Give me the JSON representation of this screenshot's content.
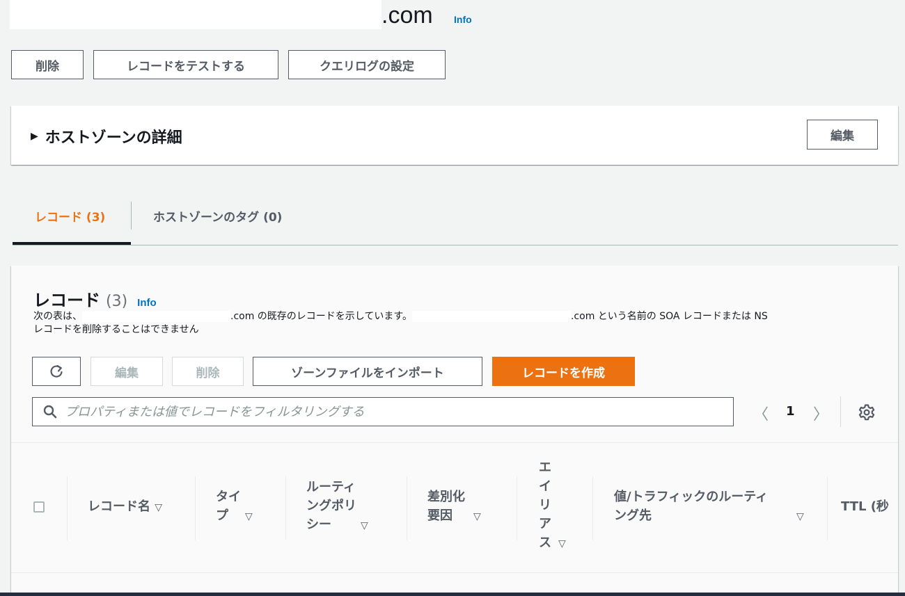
{
  "header": {
    "domain_suffix": ".com",
    "info": "Info"
  },
  "actions": {
    "delete": "削除",
    "test_record": "レコードをテストする",
    "query_log": "クエリログの設定"
  },
  "hosted_zone_details": {
    "title": "ホストゾーンの詳細",
    "edit": "編集"
  },
  "tabs": [
    {
      "label": "レコード (3)"
    },
    {
      "label": "ホストゾーンのタグ (0)"
    }
  ],
  "records": {
    "title": "レコード",
    "count": "(3)",
    "info": "Info",
    "desc_1": "次の表は、",
    "desc_2": ".com の既存のレコードを示しています。",
    "desc_3": ".com という名前の SOA レコードまたは NS",
    "desc_4": "レコードを削除することはできません",
    "edit": "編集",
    "delete": "削除",
    "import": "ゾーンファイルをインポート",
    "create": "レコードを作成",
    "search_placeholder": "プロパティまたは値でレコードをフィルタリングする",
    "page": "1",
    "columns": {
      "name": "レコード名",
      "type_1": "タイ",
      "type_2": "プ",
      "policy_1": "ルーティ",
      "policy_2": "ングポリ",
      "policy_3": "シー",
      "diff_1": "差別化",
      "diff_2": "要因",
      "alias_1": "エ",
      "alias_2": "イ",
      "alias_3": "リ",
      "alias_4": "ア",
      "alias_5": "ス",
      "value_1": "値/トラフィックのルーティ",
      "value_2": "ング先",
      "ttl": "TTL (秒"
    }
  },
  "colors": {
    "accent": "#ec7211",
    "link": "#0073bb",
    "text": "#16191f"
  }
}
